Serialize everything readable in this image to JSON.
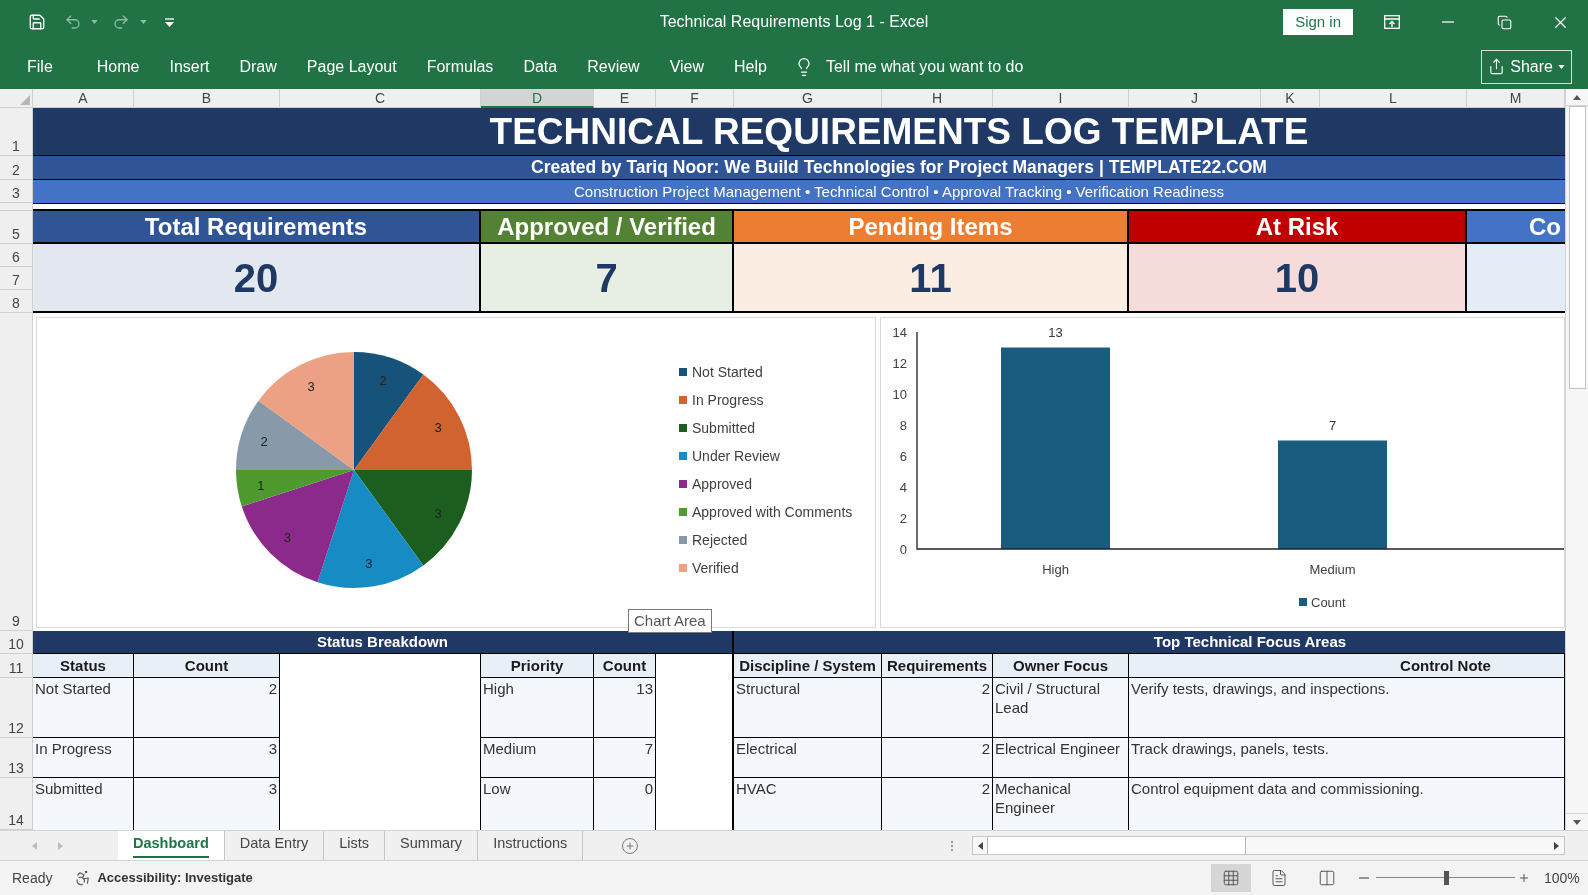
{
  "window": {
    "title": "Technical Requirements Log 1 - Excel",
    "sign_in": "Sign in"
  },
  "quick_access": [
    {
      "kind": "save",
      "disabled": false
    },
    {
      "kind": "undo",
      "disabled": true
    },
    {
      "kind": "redo",
      "disabled": true
    },
    {
      "kind": "customize",
      "disabled": false
    }
  ],
  "ribbon": {
    "tabs": [
      {
        "label": "File",
        "selected": false
      },
      {
        "label": "Home",
        "selected": false
      },
      {
        "label": "Insert",
        "selected": false
      },
      {
        "label": "Draw",
        "selected": false
      },
      {
        "label": "Page Layout",
        "selected": false
      },
      {
        "label": "Formulas",
        "selected": false
      },
      {
        "label": "Data",
        "selected": false
      },
      {
        "label": "Review",
        "selected": false
      },
      {
        "label": "View",
        "selected": false
      },
      {
        "label": "Help",
        "selected": false
      }
    ],
    "tell_me": "Tell me what you want to do",
    "share": "Share"
  },
  "columns": [
    {
      "label": "A",
      "selected": false
    },
    {
      "label": "B",
      "selected": false
    },
    {
      "label": "C",
      "selected": false
    },
    {
      "label": "D",
      "selected": true
    },
    {
      "label": "E",
      "selected": false
    },
    {
      "label": "F",
      "selected": false
    },
    {
      "label": "G",
      "selected": false
    },
    {
      "label": "H",
      "selected": false
    },
    {
      "label": "I",
      "selected": false
    },
    {
      "label": "J",
      "selected": false
    },
    {
      "label": "K",
      "selected": false
    },
    {
      "label": "L",
      "selected": false
    },
    {
      "label": "M",
      "selected": false
    }
  ],
  "row_headers": [
    "1",
    "2",
    "3",
    "5",
    "6",
    "7",
    "8",
    "9",
    "10",
    "11",
    "12",
    "13",
    "14"
  ],
  "banner": {
    "title": "TECHNICAL REQUIREMENTS LOG TEMPLATE",
    "subtitle": "Created by Tariq Noor: We Build Technologies for Project Managers | TEMPLATE22.COM",
    "tagline": "Construction Project Management • Technical Control • Approval Tracking • Verification Readiness"
  },
  "kpis": [
    {
      "label": "Total Requirements",
      "value": "20",
      "color": "#2f5597"
    },
    {
      "label": "Approved / Verified",
      "value": "7",
      "color": "#548235"
    },
    {
      "label": "Pending Items",
      "value": "11",
      "color": "#ed7d31"
    },
    {
      "label": "At Risk",
      "value": "10",
      "color": "#c00000"
    },
    {
      "label": "Co",
      "color": "#4472c4"
    }
  ],
  "charts": {
    "status_pie": {
      "chart_data": {
        "type": "pie",
        "categories": [
          "Not Started",
          "In Progress",
          "Submitted",
          "Under Review",
          "Approved",
          "Approved with Comments",
          "Rejected",
          "Verified"
        ],
        "values": [
          2,
          3,
          3,
          3,
          3,
          1,
          2,
          3
        ],
        "colors": [
          "#17527a",
          "#d06330",
          "#1b5e20",
          "#178bc4",
          "#8b2a8a",
          "#4e9a2f",
          "#8899aa",
          "#eca184"
        ],
        "data_labels": true,
        "legend": "right"
      }
    },
    "priority_bar": {
      "chart_data": {
        "type": "bar",
        "categories": [
          "High",
          "Medium"
        ],
        "series": [
          {
            "name": "Count",
            "color": "#1a5c80",
            "values": [
              13,
              7
            ]
          }
        ],
        "ylim": [
          0,
          14
        ],
        "yticks": [
          0,
          2,
          4,
          6,
          8,
          10,
          12,
          14
        ],
        "data_labels": true,
        "legend": "bottom"
      }
    },
    "tooltip": "Chart Area"
  },
  "status_breakdown": {
    "title": "Status Breakdown",
    "status_columns": [
      "Status",
      "Count"
    ],
    "status_rows": [
      [
        "Not Started",
        "2"
      ],
      [
        "In Progress",
        "3"
      ],
      [
        "Submitted",
        "3"
      ]
    ],
    "priority_columns": [
      "Priority",
      "Count"
    ],
    "priority_rows": [
      [
        "High",
        "13"
      ],
      [
        "Medium",
        "7"
      ],
      [
        "Low",
        "0"
      ]
    ]
  },
  "focus_areas": {
    "title": "Top Technical Focus Areas",
    "columns": [
      "Discipline / System",
      "Requirements",
      "Owner Focus",
      "Control Note"
    ],
    "rows": [
      [
        "Structural",
        "2",
        "Civil / Structural Lead",
        "Verify tests, drawings, and inspections."
      ],
      [
        "Electrical",
        "2",
        "Electrical Engineer",
        "Track drawings, panels, tests."
      ],
      [
        "HVAC",
        "2",
        "Mechanical Engineer",
        "Control equipment data and commissioning."
      ]
    ]
  },
  "sheet_tabs": [
    {
      "label": "Dashboard",
      "selected": true
    },
    {
      "label": "Data Entry",
      "selected": false
    },
    {
      "label": "Lists",
      "selected": false
    },
    {
      "label": "Summary",
      "selected": false
    },
    {
      "label": "Instructions",
      "selected": false
    }
  ],
  "status_bar": {
    "state": "Ready",
    "accessibility": "Accessibility: Investigate",
    "views": [
      {
        "kind": "normal",
        "selected": true
      },
      {
        "kind": "page_layout",
        "selected": false
      },
      {
        "kind": "page_break",
        "selected": false
      }
    ],
    "zoom_slider": {
      "level": 0.5
    },
    "zoom": "100%"
  }
}
